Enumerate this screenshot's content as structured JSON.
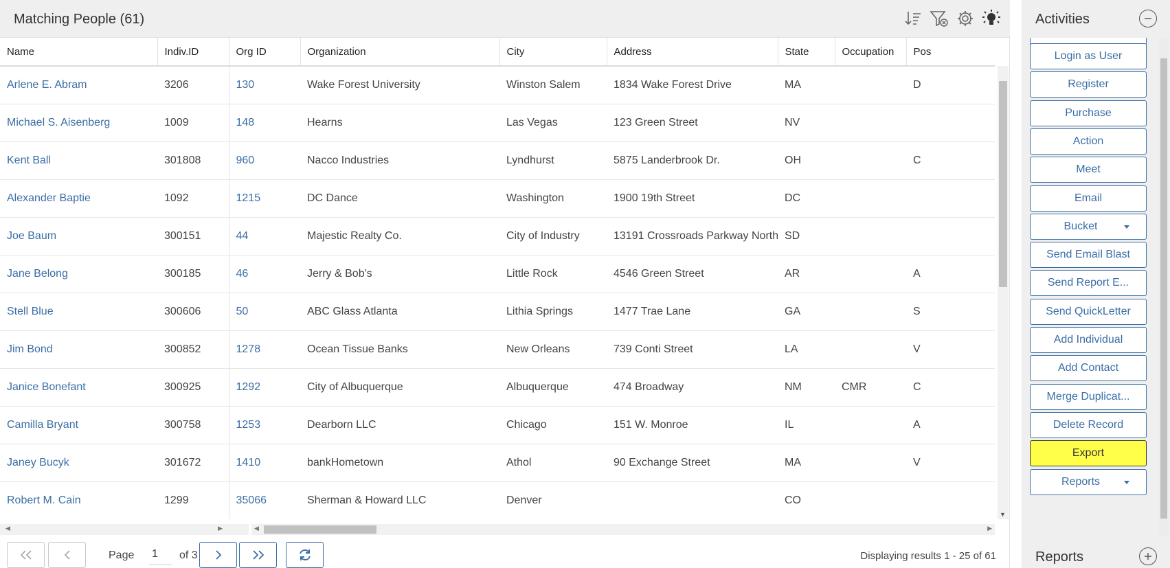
{
  "grid": {
    "title": "Matching People (61)",
    "tools": [
      "sort-icon",
      "clear-filter-icon",
      "gear-icon",
      "lightbulb-icon"
    ],
    "columns": [
      "Name",
      "Indiv.ID",
      "Org ID",
      "Organization",
      "City",
      "Address",
      "State",
      "Occupation",
      "Pos"
    ],
    "rows": [
      {
        "name": "Arlene E. Abram",
        "indiv_id": "3206",
        "org_id": "130",
        "organization": "Wake Forest University",
        "city": "Winston Salem",
        "address": "1834 Wake Forest Drive",
        "state": "MA",
        "occupation": "",
        "pos": "D"
      },
      {
        "name": "Michael S. Aisenberg",
        "indiv_id": "1009",
        "org_id": "148",
        "organization": "Hearns",
        "city": "Las Vegas",
        "address": "123 Green Street",
        "state": "NV",
        "occupation": "",
        "pos": ""
      },
      {
        "name": "Kent Ball",
        "indiv_id": "301808",
        "org_id": "960",
        "organization": "Nacco Industries",
        "city": "Lyndhurst",
        "address": "5875 Landerbrook Dr.",
        "state": "OH",
        "occupation": "",
        "pos": "C"
      },
      {
        "name": "Alexander Baptie",
        "indiv_id": "1092",
        "org_id": "1215",
        "organization": "DC Dance",
        "city": "Washington",
        "address": "1900 19th Street",
        "state": "DC",
        "occupation": "",
        "pos": ""
      },
      {
        "name": "Joe Baum",
        "indiv_id": "300151",
        "org_id": "44",
        "organization": "Majestic Realty Co.",
        "city": "City of Industry",
        "address": "13191 Crossroads Parkway North",
        "state": "SD",
        "occupation": "",
        "pos": ""
      },
      {
        "name": "Jane Belong",
        "indiv_id": "300185",
        "org_id": "46",
        "organization": "Jerry & Bob's",
        "city": "Little Rock",
        "address": "4546 Green Street",
        "state": "AR",
        "occupation": "",
        "pos": "A"
      },
      {
        "name": "Stell Blue",
        "indiv_id": "300606",
        "org_id": "50",
        "organization": "ABC Glass Atlanta",
        "city": "Lithia Springs",
        "address": "1477 Trae Lane",
        "state": "GA",
        "occupation": "",
        "pos": "S"
      },
      {
        "name": "Jim Bond",
        "indiv_id": "300852",
        "org_id": "1278",
        "organization": "Ocean Tissue Banks",
        "city": "New Orleans",
        "address": "739 Conti Street",
        "state": "LA",
        "occupation": "",
        "pos": "V"
      },
      {
        "name": "Janice Bonefant",
        "indiv_id": "300925",
        "org_id": "1292",
        "organization": "City of Albuquerque",
        "city": "Albuquerque",
        "address": "474 Broadway",
        "state": "NM",
        "occupation": "CMR",
        "pos": "C"
      },
      {
        "name": "Camilla Bryant",
        "indiv_id": "300758",
        "org_id": "1253",
        "organization": "Dearborn LLC",
        "city": "Chicago",
        "address": "151 W. Monroe",
        "state": "IL",
        "occupation": "",
        "pos": "A"
      },
      {
        "name": "Janey Bucyk",
        "indiv_id": "301672",
        "org_id": "1410",
        "organization": "bankHometown",
        "city": "Athol",
        "address": "90 Exchange Street",
        "state": "MA",
        "occupation": "",
        "pos": "V"
      },
      {
        "name": "Robert M. Cain",
        "indiv_id": "1299",
        "org_id": "35066",
        "organization": "Sherman & Howard LLC",
        "city": "Denver",
        "address": "",
        "state": "CO",
        "occupation": "",
        "pos": ""
      }
    ]
  },
  "pager": {
    "page_label": "Page",
    "page_value": "1",
    "of_label": "of 3",
    "display": "Displaying results 1 - 25 of 61"
  },
  "activities": {
    "title": "Activities",
    "buttons": [
      {
        "id": "login-as-user",
        "label": "Login as User"
      },
      {
        "id": "register",
        "label": "Register"
      },
      {
        "id": "purchase",
        "label": "Purchase"
      },
      {
        "id": "action",
        "label": "Action"
      },
      {
        "id": "meet",
        "label": "Meet"
      },
      {
        "id": "email",
        "label": "Email"
      },
      {
        "id": "bucket",
        "label": "Bucket",
        "dropdown": true
      },
      {
        "id": "send-email-blast",
        "label": "Send Email Blast"
      },
      {
        "id": "send-report",
        "label": "Send Report E..."
      },
      {
        "id": "send-quickletter",
        "label": "Send QuickLetter"
      },
      {
        "id": "add-individual",
        "label": "Add Individual"
      },
      {
        "id": "add-contact",
        "label": "Add Contact"
      },
      {
        "id": "merge-duplicates",
        "label": "Merge Duplicat..."
      },
      {
        "id": "delete-record",
        "label": "Delete Record"
      },
      {
        "id": "export",
        "label": "Export",
        "highlight": true
      },
      {
        "id": "reports-dropdown",
        "label": "Reports",
        "dropdown": true
      }
    ]
  },
  "reports": {
    "title": "Reports"
  },
  "colors": {
    "link": "#3a6ea5",
    "highlight": "#ffff4a",
    "panel_bg": "#efefef"
  }
}
